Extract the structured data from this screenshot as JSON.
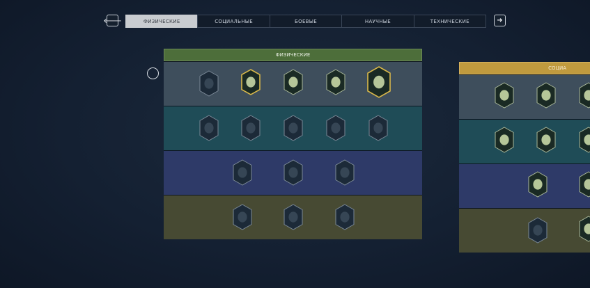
{
  "nav": {
    "prev_icon": "arrow-left-icon",
    "next_icon": "arrow-right-icon",
    "prev_glyph": "🡐",
    "next_glyph": "➜",
    "tabs": [
      {
        "label": "ФИЗИЧЕСКИЕ",
        "active": true
      },
      {
        "label": "СОЦИАЛЬНЫЕ",
        "active": false
      },
      {
        "label": "БОЕВЫЕ",
        "active": false
      },
      {
        "label": "НАУЧНЫЕ",
        "active": false
      },
      {
        "label": "ТЕХНИЧЕСКИЕ",
        "active": false
      }
    ]
  },
  "panels": {
    "physical": {
      "title": "ФИЗИЧЕСКИЕ",
      "header_color": "#4d6e3a"
    },
    "social": {
      "title": "СОЦИА",
      "header_color": "#c09a3e"
    }
  },
  "colors": {
    "tier1": "#3e4e5c",
    "tier2": "#1f4c57",
    "tier3": "#2e3a68",
    "tier4": "#474a33",
    "gold_border": "#d9b84a",
    "unlocked_fill": "#c8d7a6",
    "locked_fill": "#1c2a38"
  },
  "skills": {
    "physical_tier1": [
      "fist-icon",
      "rifle-icon",
      "pistol-icon",
      "dumbbell-icon",
      "heart-icon"
    ],
    "physical_tier2": [
      "spear-icon",
      "runner-icon",
      "lungs-icon",
      "swimmer-icon",
      "shield-icon"
    ],
    "physical_tier3": [
      "meditation-icon",
      "medal-icon",
      "muscle-icon"
    ],
    "physical_tier4": [
      "hood-icon",
      "tornado-icon",
      "emblem-icon"
    ],
    "social_tier1": [
      "beer-icon",
      "drink-icon",
      "mask-icon"
    ],
    "social_tier2": [
      "money-bag-icon",
      "handshake-icon",
      "face-icon"
    ],
    "social_tier3": [
      "crowd-icon",
      "wolf-icon"
    ],
    "social_tier4": [
      "barrel-icon",
      "skull-icon"
    ]
  }
}
